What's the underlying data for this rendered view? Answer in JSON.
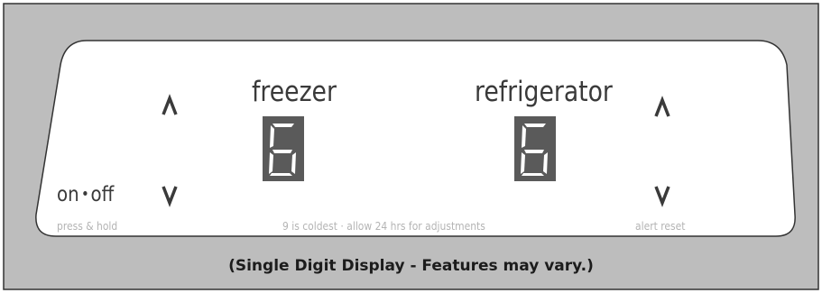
{
  "panel": {
    "freezer_label": "freezer",
    "refrigerator_label": "refrigerator",
    "freezer_value": "6",
    "refrigerator_value": "6",
    "power_label_on": "on",
    "power_label_off": "off",
    "press_hold_hint": "press & hold",
    "cold_hint": "9 is coldest · allow 24 hrs for adjustments",
    "alert_reset_label": "alert reset"
  },
  "caption": "(Single Digit Display - Features may vary.)",
  "icons": {
    "up": "chevron-up-icon",
    "down": "chevron-down-icon"
  },
  "colors": {
    "background": "#bdbdbd",
    "panel": "#ffffff",
    "border": "#333333",
    "digit_background": "#5a5a5a",
    "digit_segment": "#ffffff",
    "text_primary": "#3a3a3a",
    "text_hint": "#b4b4b4"
  }
}
